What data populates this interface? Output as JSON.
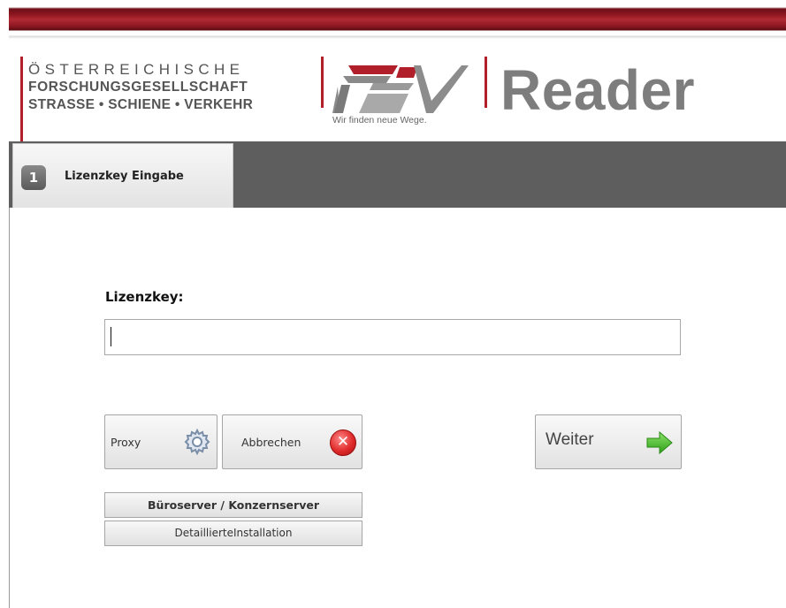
{
  "logo": {
    "line1": "ÖSTERREICHISCHE",
    "line2": "FORSCHUNGSGESELLSCHAFT",
    "line3": "STRASSE • SCHIENE • VERKEHR",
    "tagline": "Wir finden neue Wege.",
    "product": "Reader"
  },
  "tabs": [
    {
      "number": "1",
      "label": "Lizenzkey Eingabe",
      "active": true
    }
  ],
  "form": {
    "key_label": "Lizenzkey:",
    "key_value": ""
  },
  "buttons": {
    "proxy": "Proxy",
    "cancel": "Abbrechen",
    "next": "Weiter",
    "server": "Büroserver / Konzernserver",
    "detailed": "DetaillierteInstallation"
  },
  "colors": {
    "brand_red": "#b01f2a",
    "tab_bar": "#5e5e5e",
    "cancel_icon": "#e02b2b",
    "next_arrow": "#4fbf2a"
  },
  "icons": {
    "proxy": "gear-icon",
    "cancel": "close-circle-icon",
    "next": "arrow-right-icon"
  }
}
